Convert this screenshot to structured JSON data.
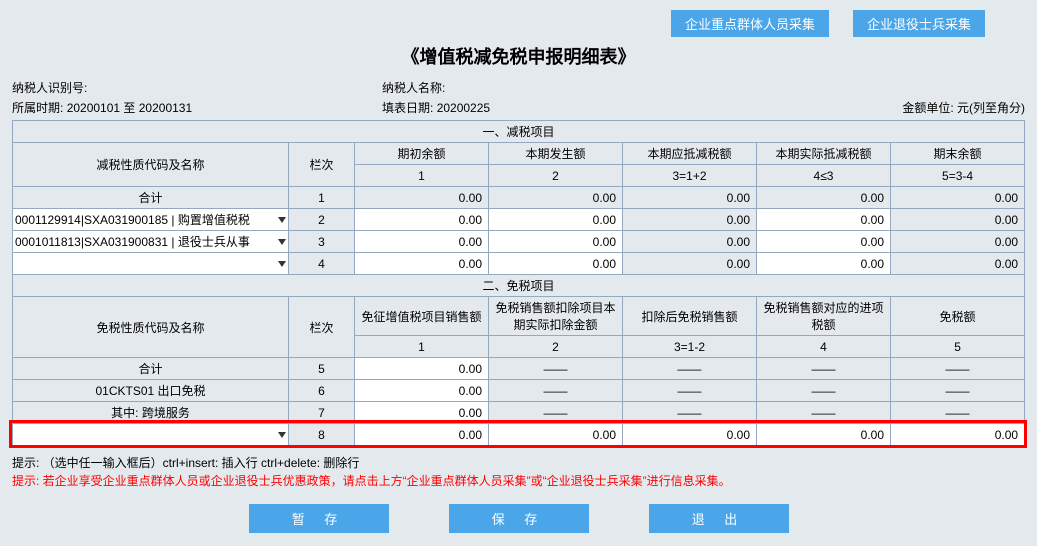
{
  "top_buttons": {
    "btn1": "企业重点群体人员采集",
    "btn2": "企业退役士兵采集"
  },
  "title": "《增值税减免税申报明细表》",
  "info": {
    "taxpayer_id_label": "纳税人识别号:",
    "taxpayer_id": "",
    "period_label": "所属时期:",
    "period_value": "20200101  至  20200131",
    "taxpayer_name_label": "纳税人名称:",
    "taxpayer_name": "",
    "fill_date_label": "填表日期:",
    "fill_date": "20200225",
    "unit_label": "金额单位:  元(列至角分)"
  },
  "section1": {
    "header": "一、减税项目",
    "col_name": "减税性质代码及名称",
    "col_idx": "栏次",
    "col1": "期初余额",
    "col2": "本期发生额",
    "col3": "本期应抵减税额",
    "col4": "本期实际抵减税额",
    "col5": "期末余额",
    "sub1": "1",
    "sub2": "2",
    "sub3": "3=1+2",
    "sub4": "4≤3",
    "sub5": "5=3-4",
    "total_label": "合计",
    "r1": {
      "idx": "1",
      "v1": "0.00",
      "v2": "0.00",
      "v3": "0.00",
      "v4": "0.00",
      "v5": "0.00"
    },
    "r2": {
      "sel": "0001129914|SXA031900185 | 购置增值税税",
      "idx": "2",
      "v1": "0.00",
      "v2": "0.00",
      "v3": "0.00",
      "v4": "0.00",
      "v5": "0.00"
    },
    "r3": {
      "sel": "0001011813|SXA031900831 | 退役士兵从事",
      "idx": "3",
      "v1": "0.00",
      "v2": "0.00",
      "v3": "0.00",
      "v4": "0.00",
      "v5": "0.00"
    },
    "r4": {
      "sel": "",
      "idx": "4",
      "v1": "0.00",
      "v2": "0.00",
      "v3": "0.00",
      "v4": "0.00",
      "v5": "0.00"
    }
  },
  "section2": {
    "header": "二、免税项目",
    "col_name": "免税性质代码及名称",
    "col_idx": "栏次",
    "col1": "免征增值税项目销售额",
    "col2": "免税销售额扣除项目本期实际扣除金额",
    "col3": "扣除后免税销售额",
    "col4": "免税销售额对应的进项税额",
    "col5": "免税额",
    "sub1": "1",
    "sub2": "2",
    "sub3": "3=1-2",
    "sub4": "4",
    "sub5": "5",
    "total_label": "合计",
    "r5": {
      "idx": "5",
      "v1": "0.00",
      "dash": "——"
    },
    "r6": {
      "name": "01CKTS01 出口免税",
      "idx": "6",
      "v1": "0.00",
      "dash": "——"
    },
    "r7": {
      "name": "其中:  跨境服务",
      "idx": "7",
      "v1": "0.00",
      "dash": "——"
    },
    "r8": {
      "sel": "",
      "idx": "8",
      "v1": "0.00",
      "v2": "0.00",
      "v3": "0.00",
      "v4": "0.00",
      "v5": "0.00"
    }
  },
  "hints": {
    "line1": "提示: （选中任一输入框后）ctrl+insert: 插入行  ctrl+delete: 删除行",
    "line2": "提示: 若企业享受企业重点群体人员或企业退役士兵优惠政策，请点击上方“企业重点群体人员采集”或“企业退役士兵采集”进行信息采集。"
  },
  "bottom": {
    "draft": "暂 存",
    "save": "保 存",
    "exit": "退 出"
  }
}
